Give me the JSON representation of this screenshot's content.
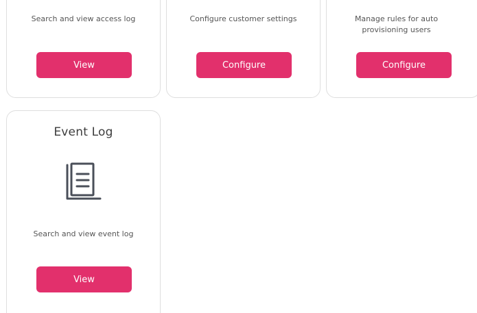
{
  "cards": [
    {
      "description": "Search and view access log",
      "button_label": "View"
    },
    {
      "description": "Configure customer settings",
      "button_label": "Configure"
    },
    {
      "description": "Manage rules for auto provisioning users",
      "button_label": "Configure"
    },
    {
      "title": "Event Log",
      "icon": "book-icon",
      "description": "Search and view event log",
      "button_label": "View"
    }
  ],
  "colors": {
    "accent": "#e2306c",
    "card_border": "#dedede",
    "icon": "#4a4f59"
  }
}
